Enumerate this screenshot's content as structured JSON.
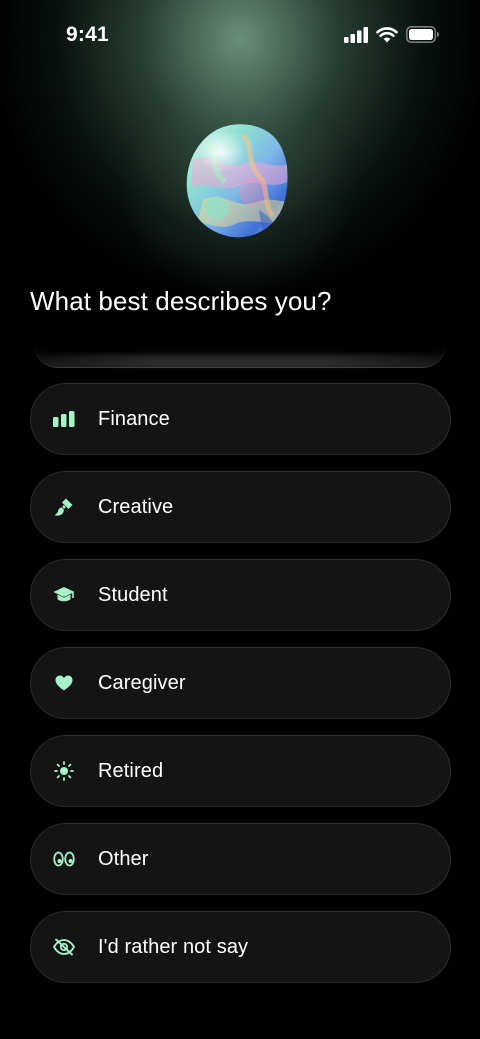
{
  "status_bar": {
    "time": "9:41",
    "icons": [
      "cellular-signal-icon",
      "wifi-icon",
      "battery-icon"
    ]
  },
  "hero": {
    "image": "opal-gem"
  },
  "question": {
    "title": "What best describes you?"
  },
  "options": [
    {
      "label": "Finance",
      "icon": "bar-chart-icon"
    },
    {
      "label": "Creative",
      "icon": "paintbrush-icon"
    },
    {
      "label": "Student",
      "icon": "graduation-cap-icon"
    },
    {
      "label": "Caregiver",
      "icon": "heart-icon"
    },
    {
      "label": "Retired",
      "icon": "sun-icon"
    },
    {
      "label": "Other",
      "icon": "eyes-icon"
    },
    {
      "label": "I'd rather not say",
      "icon": "eye-slash-icon"
    }
  ],
  "theme": {
    "accent": "#a7f3c8",
    "background": "#000000",
    "option_background": "#141414",
    "option_border": "#2c2c2c"
  }
}
